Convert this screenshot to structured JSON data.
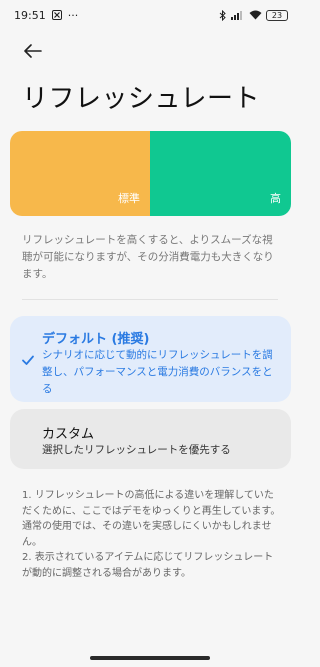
{
  "status": {
    "time": "19:51",
    "dots": "···",
    "battery": "23"
  },
  "header": {
    "title": "リフレッシュレート"
  },
  "preview": {
    "standard_label": "標準",
    "high_label": "高",
    "colors": {
      "standard": "#f7b84b",
      "high": "#10c891"
    }
  },
  "description": "リフレッシュレートを高くすると、よりスムーズな視聴が可能になりますが、その分消費電力も大きくなります。",
  "options": [
    {
      "title": "デフォルト (推奨)",
      "description": "シナリオに応じて動的にリフレッシュレートを調整し、パフォーマンスと電力消費のバランスをとる",
      "selected": true
    },
    {
      "title": "カスタム",
      "description": "選択したリフレッシュレートを優先する",
      "selected": false
    }
  ],
  "notes": [
    "1. リフレッシュレートの高低による違いを理解していただくために、ここではデモをゆっくりと再生しています。通常の使用では、その違いを実感しにくいかもしれません。",
    "2. 表示されているアイテムに応じてリフレッシュレートが動的に調整される場合があります。"
  ],
  "accent_color": "#2a7ae2"
}
